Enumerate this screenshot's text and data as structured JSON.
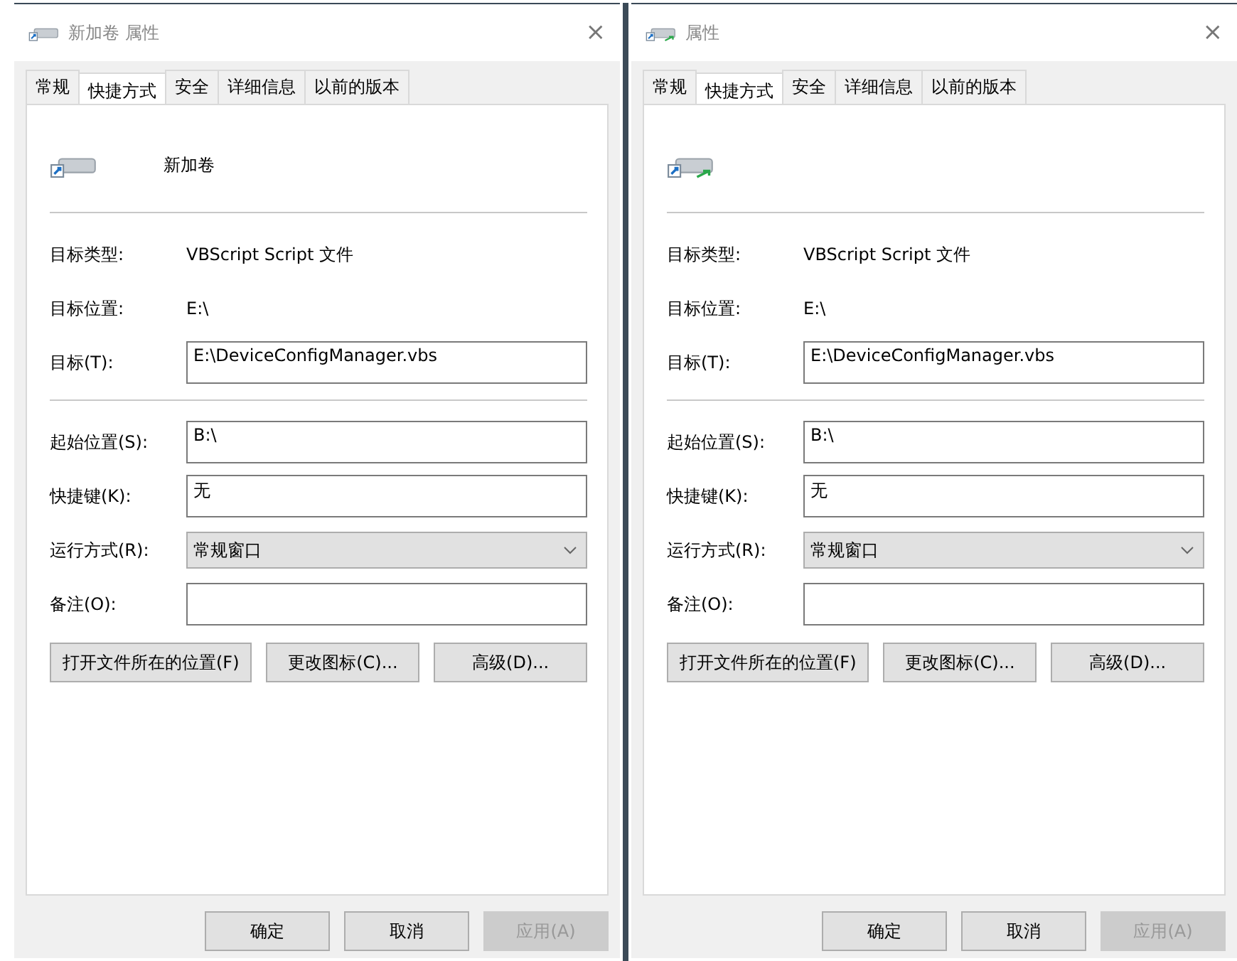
{
  "dialogs": [
    {
      "title": "新加卷 属性",
      "close": "×",
      "tabs": [
        {
          "label": "常规",
          "selected": false
        },
        {
          "label": "快捷方式",
          "selected": true
        },
        {
          "label": "安全",
          "selected": false
        },
        {
          "label": "详细信息",
          "selected": false
        },
        {
          "label": "以前的版本",
          "selected": false
        }
      ],
      "name": "新加卷",
      "fields": [
        {
          "kind": "text",
          "label": "目标类型:",
          "value": "VBScript Script 文件"
        },
        {
          "kind": "text",
          "label": "目标位置:",
          "value": "E:\\"
        },
        {
          "kind": "input",
          "label": "目标(T):",
          "value": "E:\\DeviceConfigManager.vbs"
        },
        {
          "kind": "divider"
        },
        {
          "kind": "input",
          "label": "起始位置(S):",
          "value": "B:\\"
        },
        {
          "kind": "input",
          "label": "快捷键(K):",
          "value": "无"
        },
        {
          "kind": "select",
          "label": "运行方式(R):",
          "value": "常规窗口"
        },
        {
          "kind": "input",
          "label": "备注(O):"
        }
      ],
      "actions": [
        "打开文件所在的位置(F)",
        "更改图标(C)...",
        "高级(D)..."
      ],
      "buttons": [
        {
          "label": "确定",
          "disabled": false
        },
        {
          "label": "取消",
          "disabled": false
        },
        {
          "label": "应用(A)",
          "disabled": true
        }
      ]
    },
    {
      "title": "属性",
      "close": "×",
      "tabs": [
        {
          "label": "常规",
          "selected": false
        },
        {
          "label": "快捷方式",
          "selected": true
        },
        {
          "label": "安全",
          "selected": false
        },
        {
          "label": "详细信息",
          "selected": false
        },
        {
          "label": "以前的版本",
          "selected": false
        }
      ],
      "fields": [
        {
          "kind": "text",
          "label": "目标类型:",
          "value": "VBScript Script 文件"
        },
        {
          "kind": "text",
          "label": "目标位置:",
          "value": "E:\\"
        },
        {
          "kind": "input",
          "label": "目标(T):",
          "value": "E:\\DeviceConfigManager.vbs"
        },
        {
          "kind": "divider"
        },
        {
          "kind": "input",
          "label": "起始位置(S):",
          "value": "B:\\"
        },
        {
          "kind": "input",
          "label": "快捷键(K):",
          "value": "无"
        },
        {
          "kind": "select",
          "label": "运行方式(R):",
          "value": "常规窗口"
        },
        {
          "kind": "input",
          "label": "备注(O):"
        }
      ],
      "actions": [
        "打开文件所在的位置(F)",
        "更改图标(C)...",
        "高级(D)..."
      ],
      "buttons": [
        {
          "label": "确定",
          "disabled": false
        },
        {
          "label": "取消",
          "disabled": false
        },
        {
          "label": "应用(A)",
          "disabled": true
        }
      ]
    }
  ]
}
